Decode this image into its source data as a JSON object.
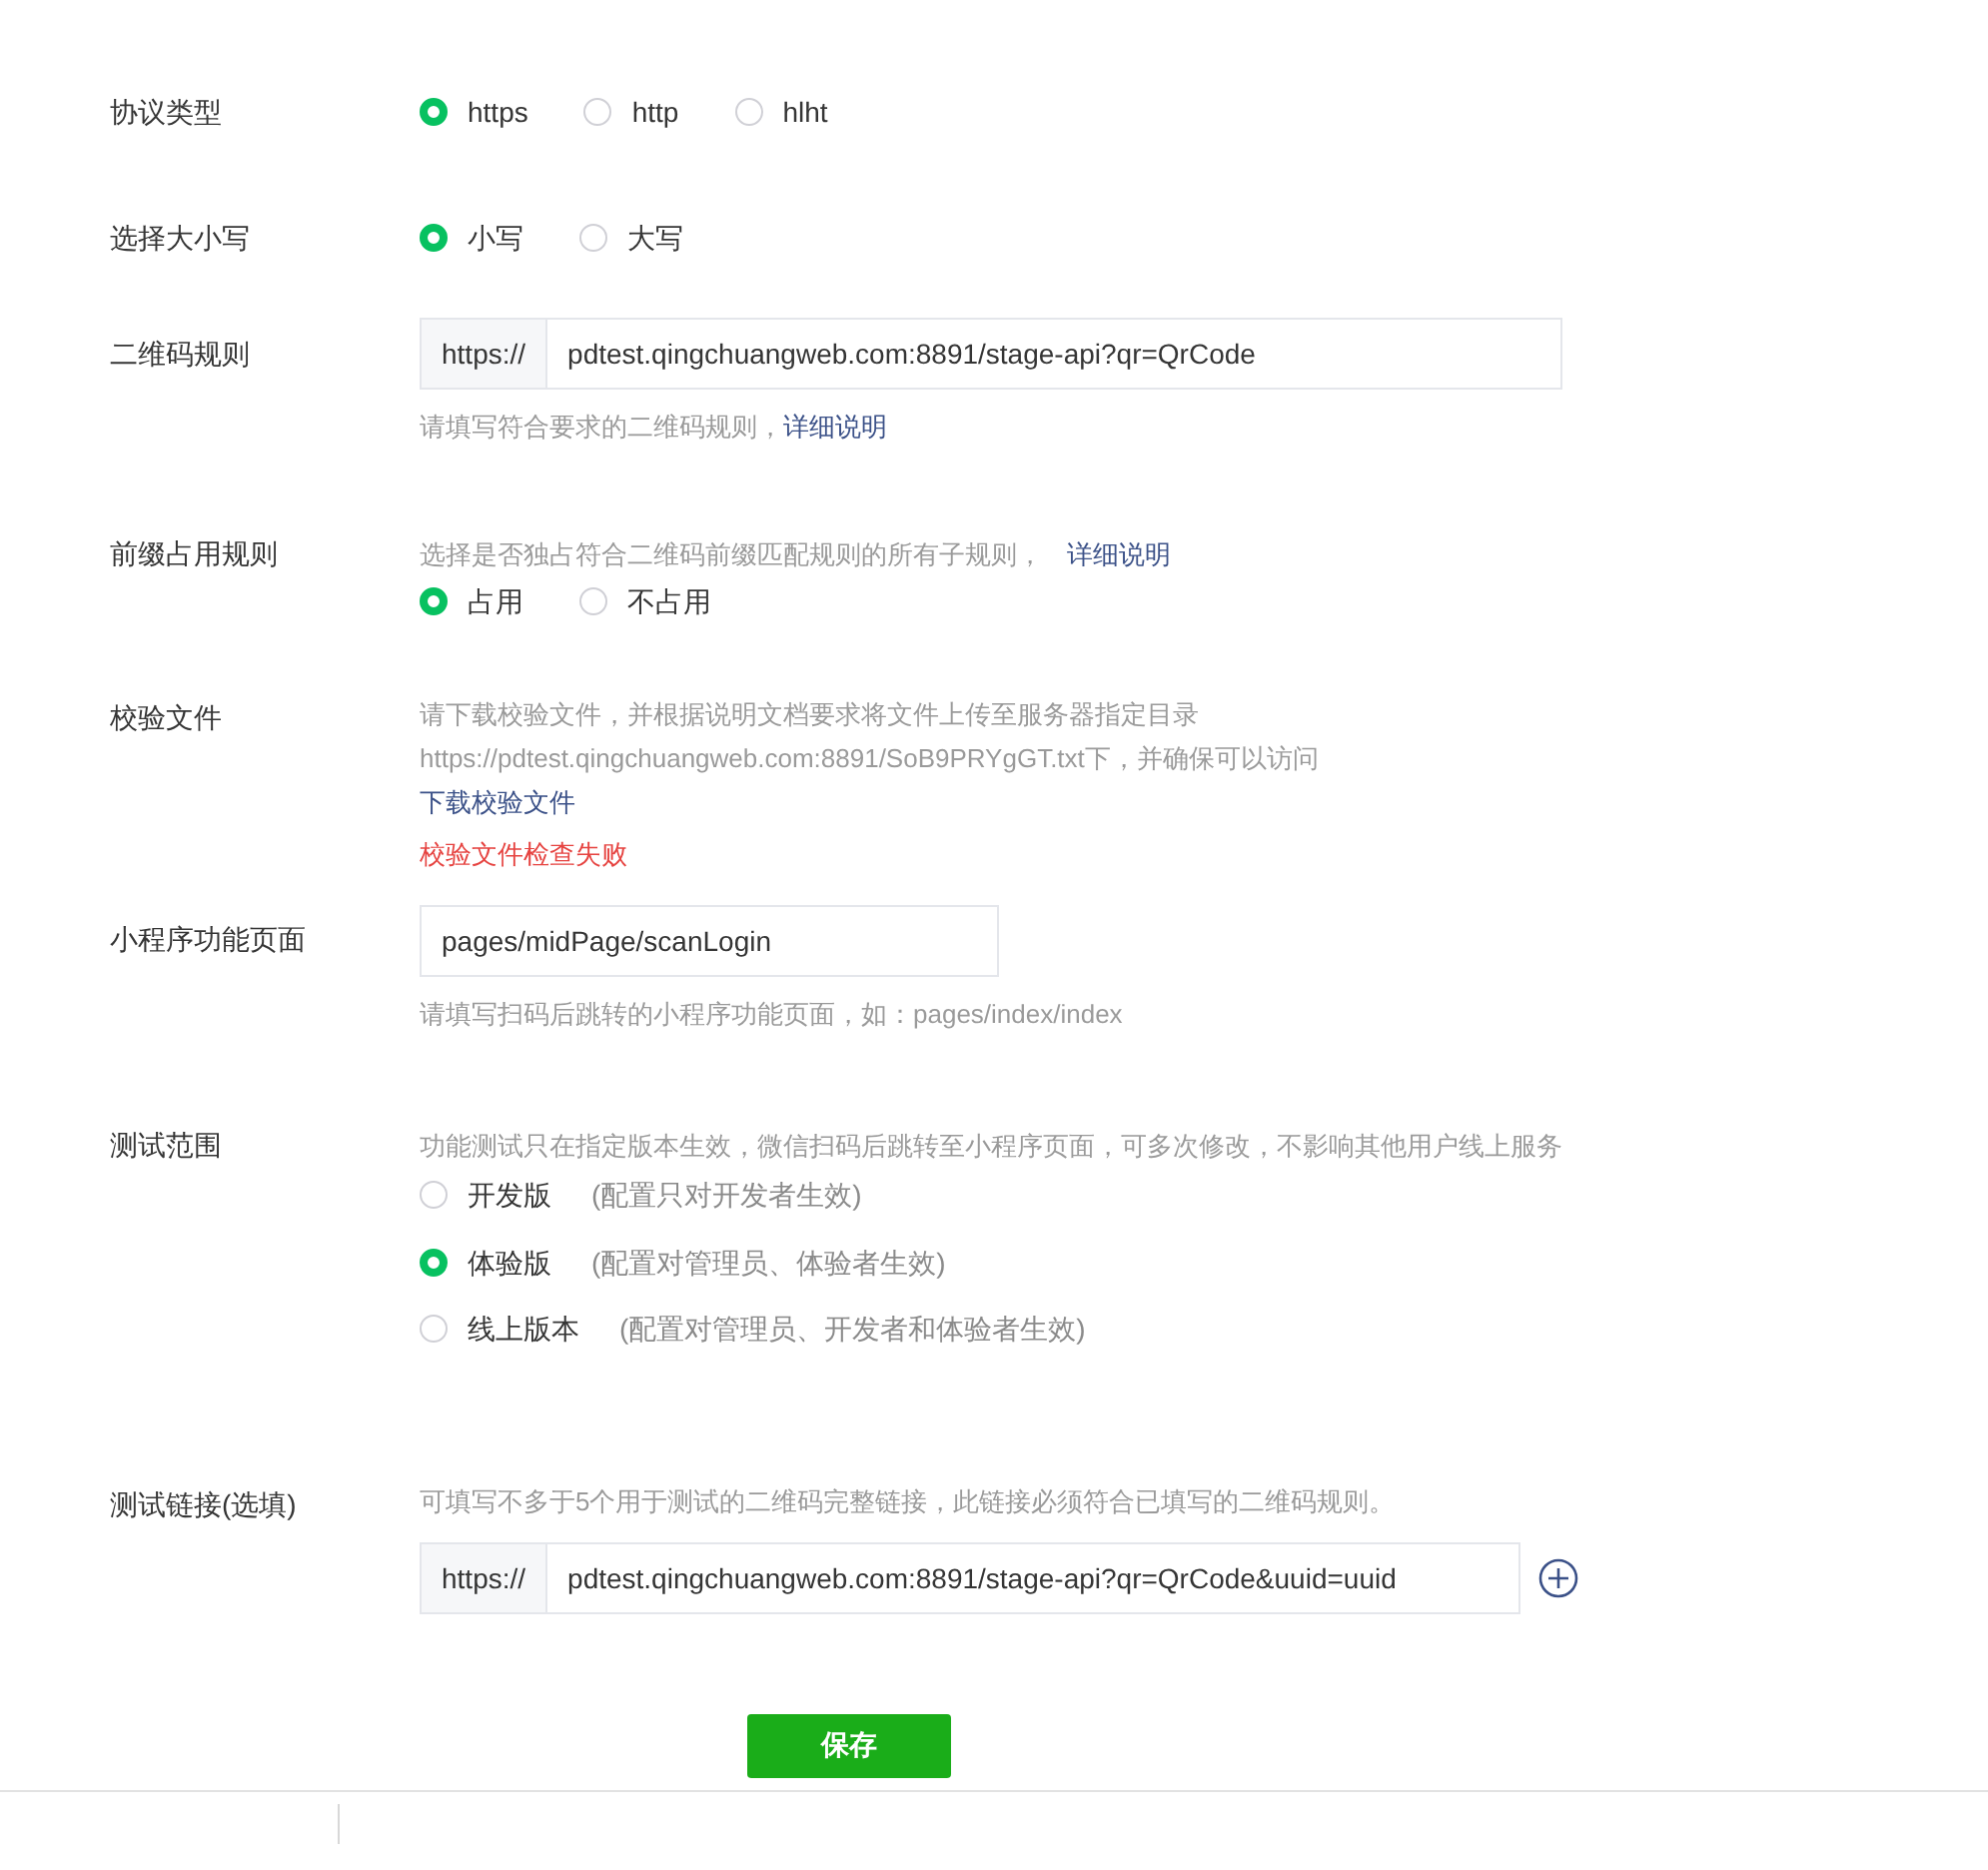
{
  "form": [
    {
      "kind": "radio",
      "label": "协议类型",
      "options": [
        {
          "label": "https",
          "selected": true
        },
        {
          "label": "http",
          "selected": false
        },
        {
          "label": "hlht",
          "selected": false
        }
      ]
    },
    {
      "kind": "radio",
      "label": "选择大小写",
      "options": [
        {
          "label": "小写",
          "selected": true
        },
        {
          "label": "大写",
          "selected": false
        }
      ]
    },
    {
      "kind": "prefixed-input",
      "label": "二维码规则",
      "prefix": "https://",
      "value": "pdtest.qingchuangweb.com:8891/stage-api?qr=QrCode",
      "hint": "请填写符合要求的二维码规则，",
      "link": "详细说明"
    },
    {
      "kind": "desc-radio",
      "label": "前缀占用规则",
      "desc": "选择是否独占符合二维码前缀匹配规则的所有子规则，",
      "link": "详细说明",
      "options": [
        {
          "label": "占用",
          "selected": true
        },
        {
          "label": "不占用",
          "selected": false
        }
      ]
    },
    {
      "kind": "file-check",
      "label": "校验文件",
      "desc": "请下载校验文件，并根据说明文档要求将文件上传至服务器指定目录https://pdtest.qingchuangweb.com:8891/SoB9PRYgGT.txt下，并确保可以访问",
      "link": "下载校验文件",
      "error": "校验文件检查失败"
    },
    {
      "kind": "input",
      "label": "小程序功能页面",
      "value": "pages/midPage/scanLogin",
      "hint": "请填写扫码后跳转的小程序功能页面，如：pages/index/index"
    },
    {
      "kind": "version-radio",
      "label": "测试范围",
      "desc": "功能测试只在指定版本生效，微信扫码后跳转至小程序页面，可多次修改，不影响其他用户线上服务",
      "options": [
        {
          "label": "开发版",
          "note": "(配置只对开发者生效)",
          "selected": false
        },
        {
          "label": "体验版",
          "note": "(配置对管理员、体验者生效)",
          "selected": true
        },
        {
          "label": "线上版本",
          "note": "(配置对管理员、开发者和体验者生效)",
          "selected": false
        }
      ]
    },
    {
      "kind": "test-link",
      "label": "测试链接(选填)",
      "desc": "可填写不多于5个用于测试的二维码完整链接，此链接必须符合已填写的二维码规则。",
      "prefix": "https://",
      "value": "pdtest.qingchuangweb.com:8891/stage-api?qr=QrCode&uuid=uuid"
    }
  ],
  "save_button": "保存"
}
